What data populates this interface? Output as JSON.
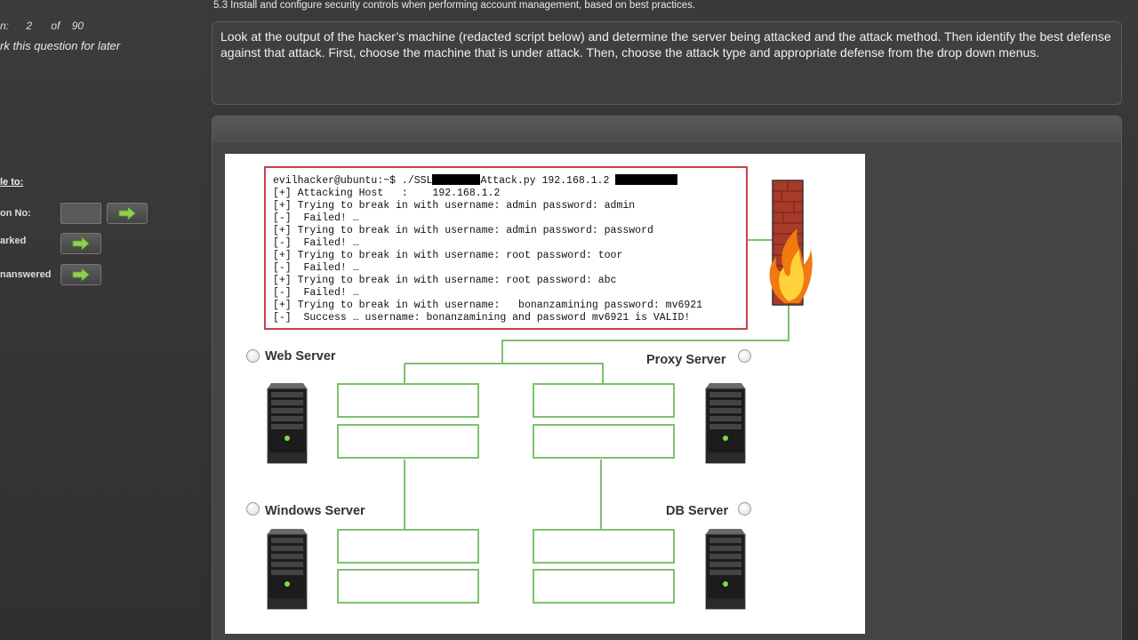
{
  "sidebar": {
    "question_label": "n:",
    "question_number": "2",
    "of_label": "of",
    "total_questions": "90",
    "mark_later": "rk this question for later",
    "goto_title": "le to:",
    "question_no_label": "on No:",
    "marked_label": "arked",
    "unanswered_label": "nanswered"
  },
  "header": {
    "section": "5.3 Install and configure security controls when performing account management, based on best practices."
  },
  "question": {
    "text": "Look at the output of the hacker’s machine (redacted script below) and determine the server being attacked and the attack method. Then identify the best defense against that attack. First, choose the machine that is under attack. Then, choose the attack type and appropriate defense from the drop down menus."
  },
  "terminal": {
    "prompt": "evilhacker@ubuntu:~$ ./SSL",
    "prompt_mid": "Attack.py 192.168.1.2 ",
    "lines": [
      "[+] Attacking Host   :    192.168.1.2",
      "[+] Trying to break in with username: admin password: admin",
      "[-]  Failed! …",
      "[+] Trying to break in with username: admin password: password",
      "[-]  Failed! …",
      "[+] Trying to break in with username: root password: toor",
      "[-]  Failed! …",
      "[+] Trying to break in with username: root password: abc",
      "[-]  Failed! …",
      "[+] Trying to break in with username:   bonanzamining password: mv6921",
      "[-]  Success … username: bonanzamining and password mv6921 is VALID!"
    ]
  },
  "servers": {
    "web": "Web Server",
    "proxy": "Proxy Server",
    "windows": "Windows Server",
    "db": "DB Server"
  },
  "colors": {
    "connector": "#7fbf6e",
    "terminal_border": "#c8404a",
    "arrow": "#8fd14f"
  }
}
